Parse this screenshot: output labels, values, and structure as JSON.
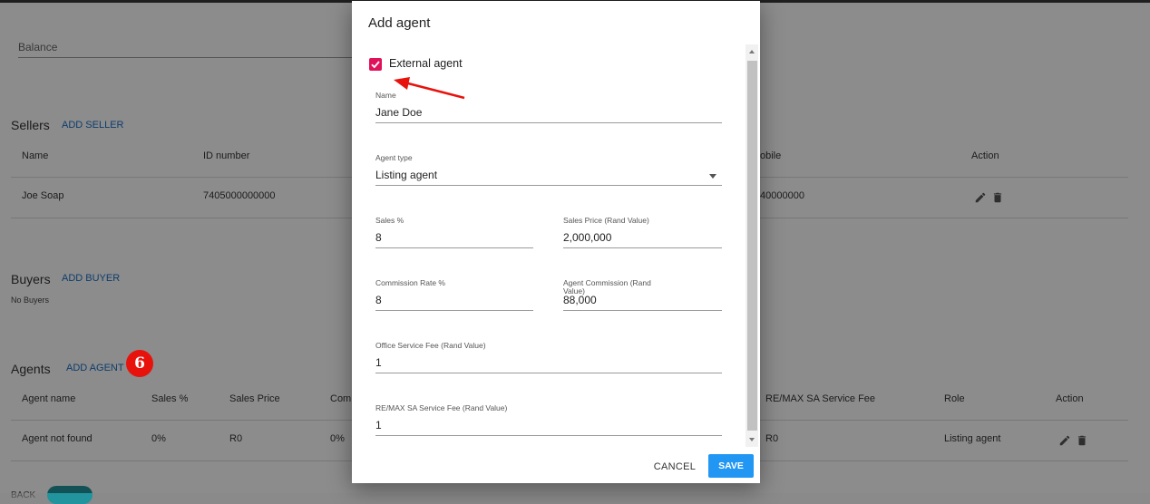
{
  "balance": {
    "label": "Balance"
  },
  "sellers": {
    "title": "Sellers",
    "add_label": "ADD SELLER",
    "columns": {
      "name": "Name",
      "id": "ID number",
      "mobile": "obile",
      "action": "Action"
    },
    "rows": [
      {
        "name": "Joe Soap",
        "id": "7405000000000",
        "mobile": "40000000"
      }
    ]
  },
  "buyers": {
    "title": "Buyers",
    "add_label": "ADD BUYER",
    "empty": "No Buyers"
  },
  "agents": {
    "title": "Agents",
    "add_label": "ADD AGENT",
    "columns": {
      "name": "Agent name",
      "sales_pct": "Sales %",
      "sales_price": "Sales Price",
      "com": "Com",
      "remax_fee": "RE/MAX SA Service Fee",
      "role": "Role",
      "action": "Action"
    },
    "rows": [
      {
        "name": "Agent not found",
        "sales_pct": "0%",
        "sales_price": "R0",
        "com": "0%",
        "remax_fee": "R0",
        "role": "Listing agent"
      }
    ]
  },
  "annotation": {
    "step_number": "6",
    "badge_color": "#e8120c",
    "arrow_color": "#e8120c"
  },
  "bottom": {
    "back_label": "BACK"
  },
  "dialog": {
    "title": "Add agent",
    "external_agent": {
      "label": "External agent",
      "checked": true,
      "color": "#e0115a"
    },
    "fields": {
      "name": {
        "label": "Name",
        "value": "Jane Doe"
      },
      "agent_type": {
        "label": "Agent type",
        "value": "Listing agent"
      },
      "sales_pct": {
        "label": "Sales %",
        "value": "8"
      },
      "sales_price": {
        "label": "Sales Price (Rand Value)",
        "value": "2,000,000"
      },
      "commission_rate": {
        "label": "Commission Rate %",
        "value": "8"
      },
      "agent_commission": {
        "label": "Agent Commission (Rand Value)",
        "value": "88,000"
      },
      "office_fee": {
        "label": "Office Service Fee (Rand Value)",
        "value": "1"
      },
      "remax_fee": {
        "label": "RE/MAX SA Service Fee (Rand Value)",
        "value": "1"
      }
    },
    "buttons": {
      "cancel": "CANCEL",
      "save": "SAVE",
      "save_color": "#2196f3"
    }
  }
}
